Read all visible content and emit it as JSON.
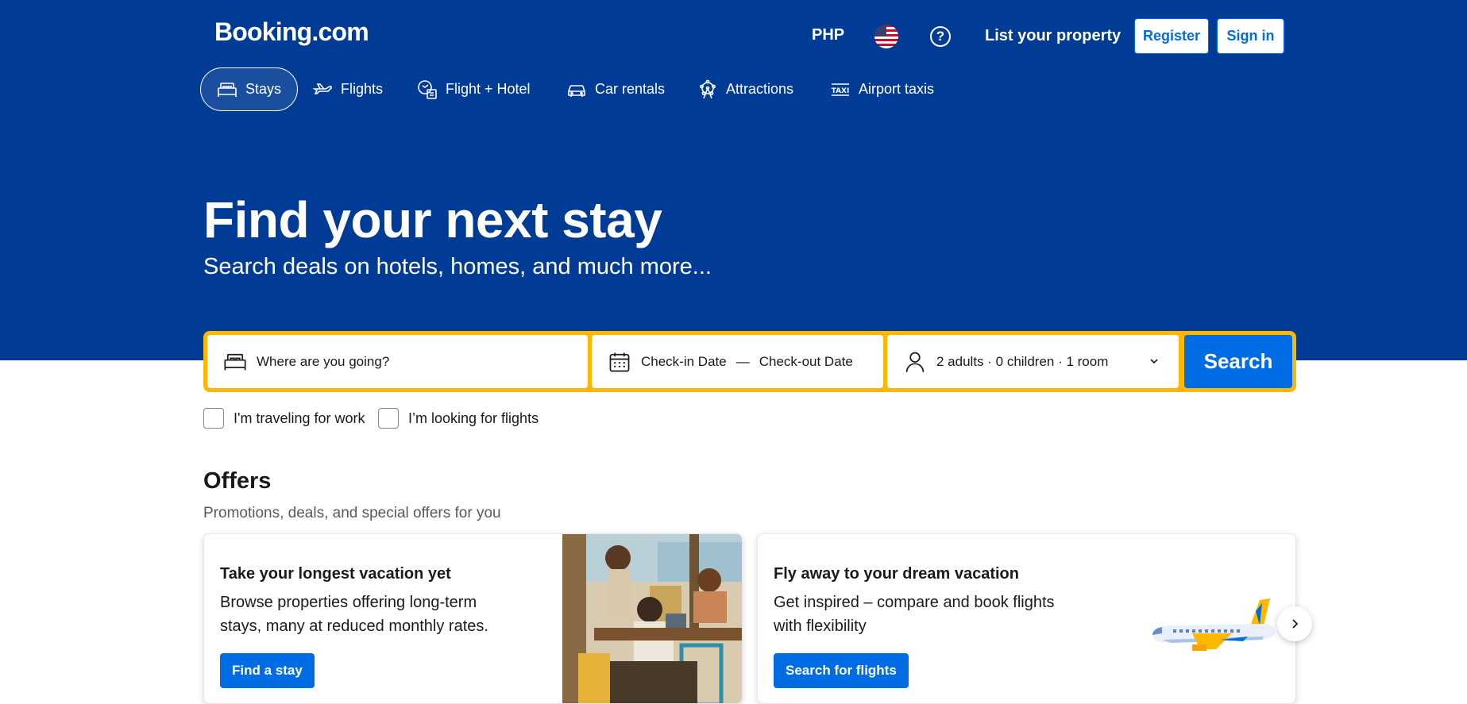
{
  "header": {
    "logo": "Booking.com",
    "currency": "PHP",
    "flag_icon": "us-flag-icon",
    "help_icon": "question-circle-icon",
    "list_property": "List your property",
    "register": "Register",
    "sign_in": "Sign in"
  },
  "nav": {
    "tabs": [
      {
        "label": "Stays",
        "icon": "bed-icon",
        "active": true
      },
      {
        "label": "Flights",
        "icon": "plane-icon"
      },
      {
        "label": "Flight + Hotel",
        "icon": "flight-hotel-icon"
      },
      {
        "label": "Car rentals",
        "icon": "car-icon"
      },
      {
        "label": "Attractions",
        "icon": "ferris-wheel-icon"
      },
      {
        "label": "Airport taxis",
        "icon": "taxi-icon"
      }
    ]
  },
  "hero": {
    "title": "Find your next stay",
    "subtitle": "Search deals on hotels, homes, and much more..."
  },
  "search": {
    "destination_placeholder": "Where are you going?",
    "checkin": "Check-in Date",
    "separator": "—",
    "checkout": "Check-out Date",
    "occupancy": "2 adults · 0 children · 1 room",
    "button": "Search"
  },
  "options": {
    "work": "I'm traveling for work",
    "flights": "I’m looking for flights"
  },
  "offers": {
    "title": "Offers",
    "subtitle": "Promotions, deals, and special offers for you",
    "cards": [
      {
        "title": "Take your longest vacation yet",
        "description": "Browse properties offering long-term stays, many at reduced monthly rates.",
        "button": "Find a stay"
      },
      {
        "title": "Fly away to your dream vacation",
        "description": "Get inspired – compare and book flights with flexibility",
        "button": "Search for flights"
      }
    ]
  },
  "colors": {
    "brand_blue": "#003b95",
    "action_blue": "#006ce4",
    "search_border": "#ffb700"
  }
}
